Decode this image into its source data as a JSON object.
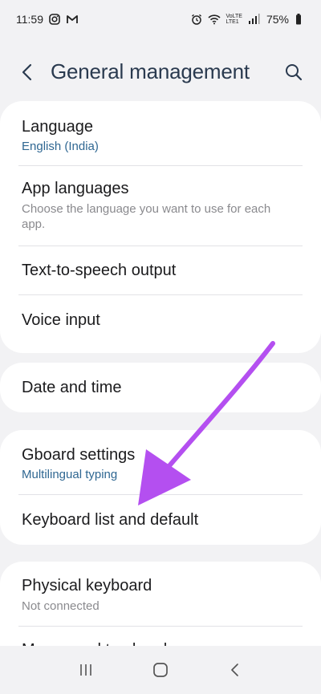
{
  "status_bar": {
    "time": "11:59",
    "network_label_top": "VoLTE",
    "network_label_bottom": "LTE1",
    "battery": "75%"
  },
  "header": {
    "title": "General management"
  },
  "cards": {
    "language": {
      "items": [
        {
          "title": "Language",
          "subtitle": "English (India)"
        },
        {
          "title": "App languages",
          "description": "Choose the language you want to use for each app."
        },
        {
          "title": "Text-to-speech output"
        },
        {
          "title": "Voice input"
        }
      ]
    },
    "datetime": {
      "items": [
        {
          "title": "Date and time"
        }
      ]
    },
    "keyboard": {
      "items": [
        {
          "title": "Gboard settings",
          "subtitle": "Multilingual typing"
        },
        {
          "title": "Keyboard list and default"
        }
      ]
    },
    "physical": {
      "items": [
        {
          "title": "Physical keyboard",
          "description": "Not connected"
        },
        {
          "title": "Mouse and trackpad"
        }
      ]
    }
  },
  "icons": {
    "back": "chevron-left-icon",
    "search": "search-icon",
    "recents": "recents-icon",
    "home": "home-icon",
    "nav_back": "nav-back-icon"
  },
  "colors": {
    "accent_text": "#2f6792",
    "annotation_arrow": "#b44ff0",
    "background": "#f2f2f4"
  }
}
